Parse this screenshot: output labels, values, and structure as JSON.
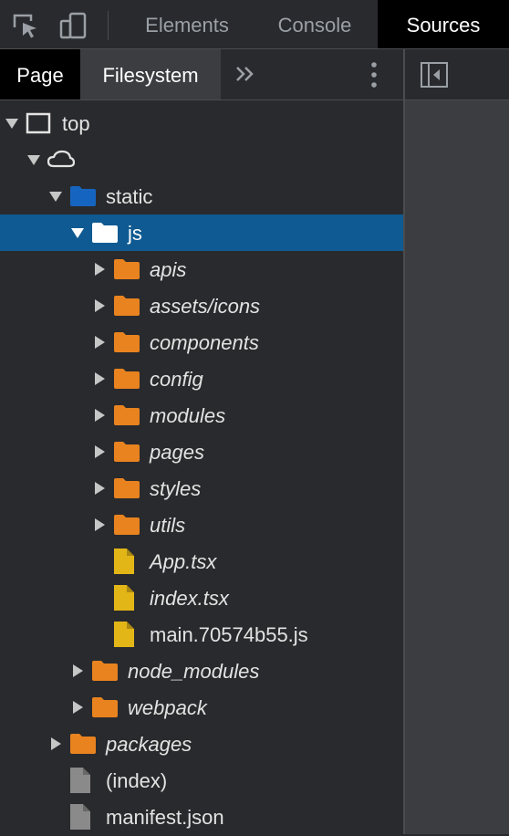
{
  "toolbar": {
    "icons": [
      "inspect-element-icon",
      "device-toolbar-icon"
    ],
    "tabs": [
      {
        "label": "Elements",
        "active": false
      },
      {
        "label": "Console",
        "active": false
      },
      {
        "label": "Sources",
        "active": true
      }
    ]
  },
  "navigator": {
    "tabs": [
      {
        "label": "Page",
        "active": true
      },
      {
        "label": "Filesystem",
        "active": false
      }
    ],
    "more_tabs_icon": "chevron-double-right-icon",
    "menu_icon": "kebab-menu-icon"
  },
  "tree": [
    {
      "label": "top",
      "type": "frame",
      "expanded": true
    },
    {
      "label": "",
      "type": "domain",
      "expanded": true
    },
    {
      "label": "static",
      "type": "folder-blue",
      "expanded": true
    },
    {
      "label": "js",
      "type": "folder-white",
      "expanded": true,
      "selected": true
    },
    {
      "label": "apis",
      "type": "folder",
      "expanded": false
    },
    {
      "label": "assets/icons",
      "type": "folder",
      "expanded": false
    },
    {
      "label": "components",
      "type": "folder",
      "expanded": false
    },
    {
      "label": "config",
      "type": "folder",
      "expanded": false
    },
    {
      "label": "modules",
      "type": "folder",
      "expanded": false
    },
    {
      "label": "pages",
      "type": "folder",
      "expanded": false
    },
    {
      "label": "styles",
      "type": "folder",
      "expanded": false
    },
    {
      "label": "utils",
      "type": "folder",
      "expanded": false
    },
    {
      "label": "App.tsx",
      "type": "file-yellow"
    },
    {
      "label": "index.tsx",
      "type": "file-yellow"
    },
    {
      "label": "main.70574b55.js",
      "type": "file-yellow"
    },
    {
      "label": "node_modules",
      "type": "folder",
      "expanded": false
    },
    {
      "label": "webpack",
      "type": "folder",
      "expanded": false
    },
    {
      "label": "packages",
      "type": "folder",
      "expanded": false
    },
    {
      "label": "(index)",
      "type": "file-gray"
    },
    {
      "label": "manifest.json",
      "type": "file-gray"
    }
  ],
  "editor": {
    "toggle_icon": "toggle-navigator-icon"
  },
  "colors": {
    "background": "#292a2d",
    "selected_row": "#0f5a92",
    "folder_orange": "#e8831f",
    "folder_blue": "#1565c0",
    "file_yellow": "#e3b618",
    "file_gray": "#8a8a8a"
  }
}
